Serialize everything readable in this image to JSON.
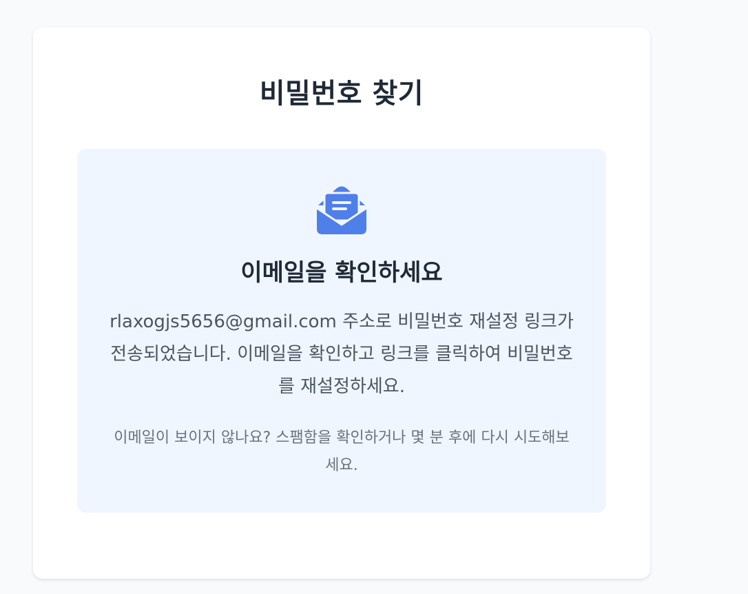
{
  "page": {
    "title": "비밀번호 찾기"
  },
  "notice": {
    "icon": "mail-open-icon",
    "icon_color": "#4f7fe8",
    "heading": "이메일을 확인하세요",
    "message": "rlaxogjs5656@gmail.com 주소로 비밀번호 재설정 링크가 전송되었습니다. 이메일을 확인하고 링크를 클릭하여 비밀번호를 재설정하세요.",
    "hint": "이메일이 보이지 않나요? 스팸함을 확인하거나 몇 분 후에 다시 시도해보세요."
  },
  "colors": {
    "page_background": "#f8fafc",
    "card_background": "#ffffff",
    "notice_background": "#eff6ff",
    "heading_text": "#1f2937",
    "body_text": "#4b5563",
    "hint_text": "#6b7280"
  }
}
